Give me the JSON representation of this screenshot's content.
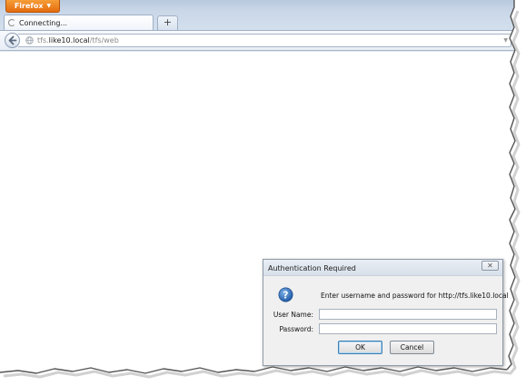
{
  "app": {
    "menu_button_label": "Firefox",
    "menu_button_arrow": "▼"
  },
  "tabs": [
    {
      "title": "Connecting...",
      "status_icon": "loading-spinner-icon"
    }
  ],
  "new_tab_label": "+",
  "urlbar": {
    "host_prefix": "tfs.",
    "domain": "like10.local",
    "path": "/tfs/web",
    "dropmarker": "▼"
  },
  "dialog": {
    "title": "Authentication Required",
    "close_label": "✕",
    "message": "Enter username and password for http://tfs.like10.local",
    "username_label": "User Name:",
    "password_label": "Password:",
    "username_value": "",
    "password_value": "",
    "ok_label": "OK",
    "cancel_label": "Cancel",
    "icon": "question-icon"
  },
  "colors": {
    "firefox_button": "#e8740f",
    "question_icon": "#2d6bb3"
  }
}
